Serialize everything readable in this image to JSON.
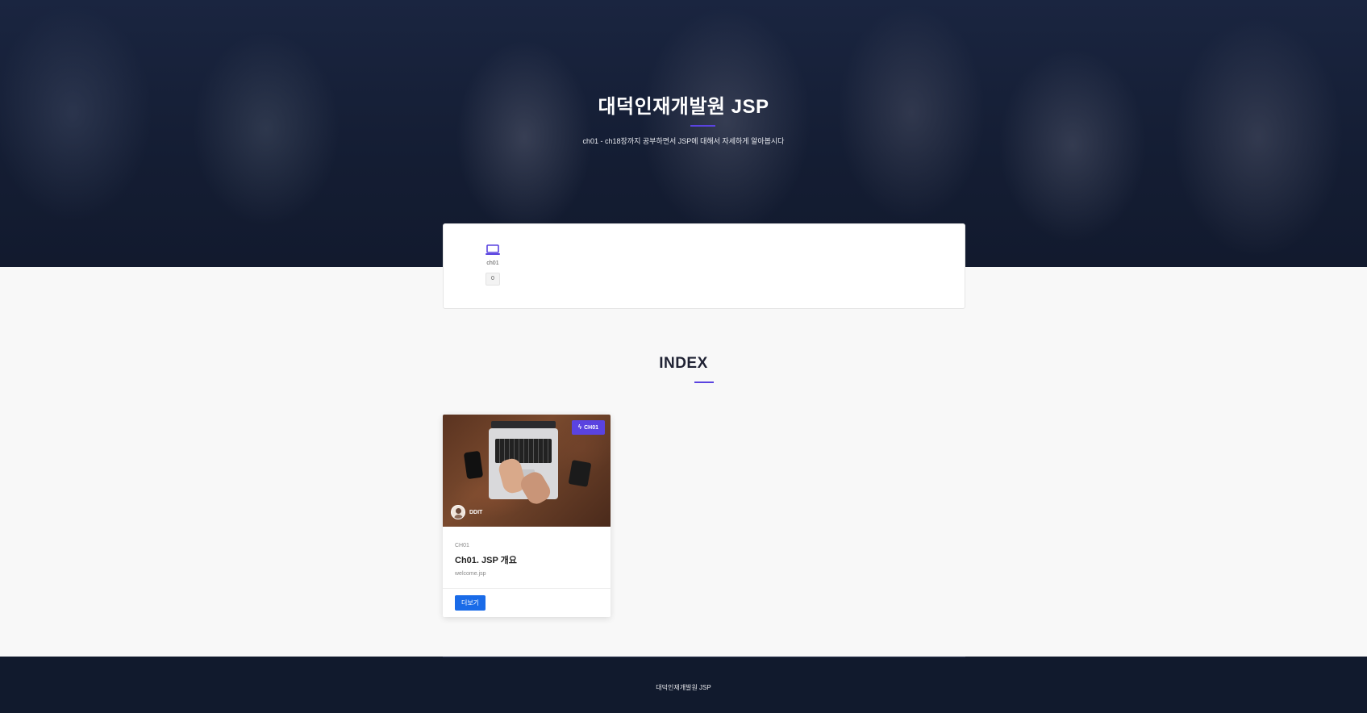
{
  "hero": {
    "title": "대덕인재개발원 JSP",
    "subtitle": "ch01 - ch18장까지 공부하면서 JSP에 대해서 자세하게 알아봅시다"
  },
  "features": [
    {
      "icon": "laptop-icon",
      "label": "ch01",
      "count": "0"
    }
  ],
  "index_section": {
    "title": "INDEX"
  },
  "cards": [
    {
      "badge": "CH01",
      "badge_icon": "bolt-icon",
      "author": "DDIT",
      "category": "CH01",
      "title": "Ch01. JSP 개요",
      "subtitle": "welcome.jsp",
      "button_label": "더보기"
    }
  ],
  "footer": {
    "text": "대덕인재개발원 JSP"
  },
  "colors": {
    "accent": "#5a43e0",
    "button": "#1a6be8",
    "hero_bg": "#141d33",
    "footer_bg": "#111a2d"
  }
}
